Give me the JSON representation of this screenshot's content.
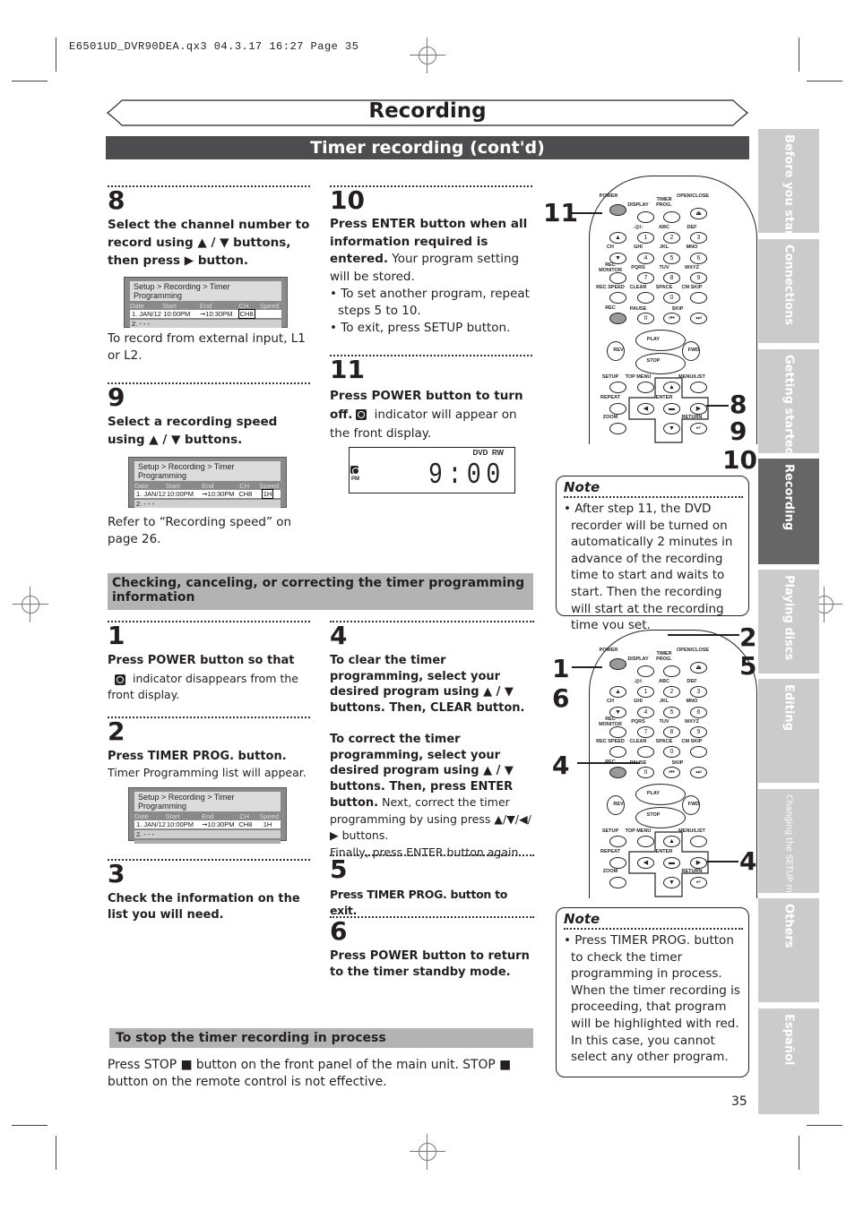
{
  "slug": "E6501UD_DVR90DEA.qx3   04.3.17   16:27   Page 35",
  "header": {
    "section_title": "Recording",
    "subtitle": "Timer recording (cont'd)"
  },
  "steps_top": [
    {
      "num": "8",
      "bold": "Select the channel number to record using ▲ / ▼ buttons, then press ▶ button.",
      "after": "To record from external input, L1 or L2."
    },
    {
      "num": "9",
      "bold": "Select a recording speed using ▲ / ▼ buttons.",
      "after": "Refer to “Recording speed” on page 26."
    },
    {
      "num": "10",
      "bold": "Press ENTER button when all information required is entered.",
      "normal": " Your program setting will be stored.",
      "bullets": [
        "• To set another program, repeat steps 5 to 10.",
        "• To exit, press SETUP button."
      ]
    },
    {
      "num": "11",
      "bold": "Press POWER button to turn off.",
      "normal": " indicator will appear on the front display."
    }
  ],
  "screen": {
    "breadcrumb": "Setup > Recording > Timer Programming",
    "columns": [
      "Date",
      "Start",
      "End",
      "CH",
      "Speed"
    ],
    "row1": {
      "date": "1. JAN/12",
      "start": "10:00PM",
      "arrow": "➞",
      "end": "10:30PM",
      "ch": "CH8",
      "speed": "1H"
    },
    "row2": "2. - - -"
  },
  "lcd": {
    "labels": [
      "DVD",
      "RW"
    ],
    "pm": "PM",
    "time": "9:00"
  },
  "note1": {
    "title": "Note",
    "body": "• After step 11, the DVD recorder will be turned on automatically 2 minutes in advance of the recording time to start and waits to start. Then the recording will start at the recording time you set."
  },
  "checking_header": "Checking, canceling, or correcting the timer programming information",
  "steps_bottom": [
    {
      "num": "1",
      "bold": "Press POWER button so that",
      "normal": " indicator disappears from the front display."
    },
    {
      "num": "2",
      "bold": "Press TIMER PROG. button.",
      "normal": "Timer Programming list will appear."
    },
    {
      "num": "3",
      "bold": "Check the information on the list you will need."
    },
    {
      "num": "4",
      "bold1": "To clear the timer programming, select your desired program using ▲ / ▼ buttons. Then, CLEAR button.",
      "bold2": "To correct the timer programming, select your desired program using ▲ / ▼ buttons. Then, press ENTER button.",
      "normal2": " Next, correct the timer programming by using press ▲/▼/◀/▶ buttons.",
      "normal3": "Finally, press ENTER button again."
    },
    {
      "num": "5",
      "bold": "Press TIMER PROG. button to exit."
    },
    {
      "num": "6",
      "bold": "Press POWER button to return to the timer standby mode."
    }
  ],
  "stop_header": "To stop the timer recording in process",
  "stop_body": "Press STOP ■ button on the front panel of the main unit. STOP ■ button on the remote control is not effective.",
  "note2": {
    "title": "Note",
    "body": "• Press TIMER PROG. button to check the timer programming in process.",
    "body2": "When the timer recording is proceeding, that program will be highlighted with red. In this case, you cannot select any other program."
  },
  "remote": {
    "labels": {
      "power": "POWER",
      "display": "DISPLAY",
      "timer": "TIMER PROG.",
      "open": "OPEN/CLOSE",
      "k1": ".@/:",
      "abc": "ABC",
      "def": "DEF",
      "ch": "CH",
      "ghi": "GHI",
      "jkl": "JKL",
      "mno": "MNO",
      "recmon": "REC MONITOR",
      "pqrs": "PQRS",
      "tuv": "TUV",
      "wxyz": "WXYZ",
      "recspeed": "REC SPEED",
      "clear": "CLEAR",
      "space": "SPACE",
      "cmskip": "CM SKIP",
      "rec": "REC",
      "pause": "PAUSE",
      "skip": "SKIP",
      "play": "PLAY",
      "rev": "REV",
      "fwd": "FWD",
      "stop": "STOP",
      "setup": "SETUP",
      "topmenu": "TOP MENU",
      "menulist": "MENU/LIST",
      "repeat": "REPEAT",
      "enter": "ENTER",
      "zoom": "ZOOM",
      "return": "RETURN"
    },
    "digits": [
      "1",
      "2",
      "3",
      "4",
      "5",
      "6",
      "7",
      "8",
      "9",
      "0"
    ],
    "callouts_top": {
      "left": "11",
      "right": [
        "8",
        "9",
        "10"
      ]
    },
    "callouts_bottom": {
      "left": [
        "1",
        "6",
        "4"
      ],
      "right_top": [
        "2",
        "5"
      ],
      "right_bottom": "4"
    }
  },
  "side_tabs": [
    "Before you start",
    "Connections",
    "Getting started",
    "Recording",
    "Playing discs",
    "Editing",
    "Changing the SETUP menu",
    "Others",
    "Español"
  ],
  "page_number": "35"
}
